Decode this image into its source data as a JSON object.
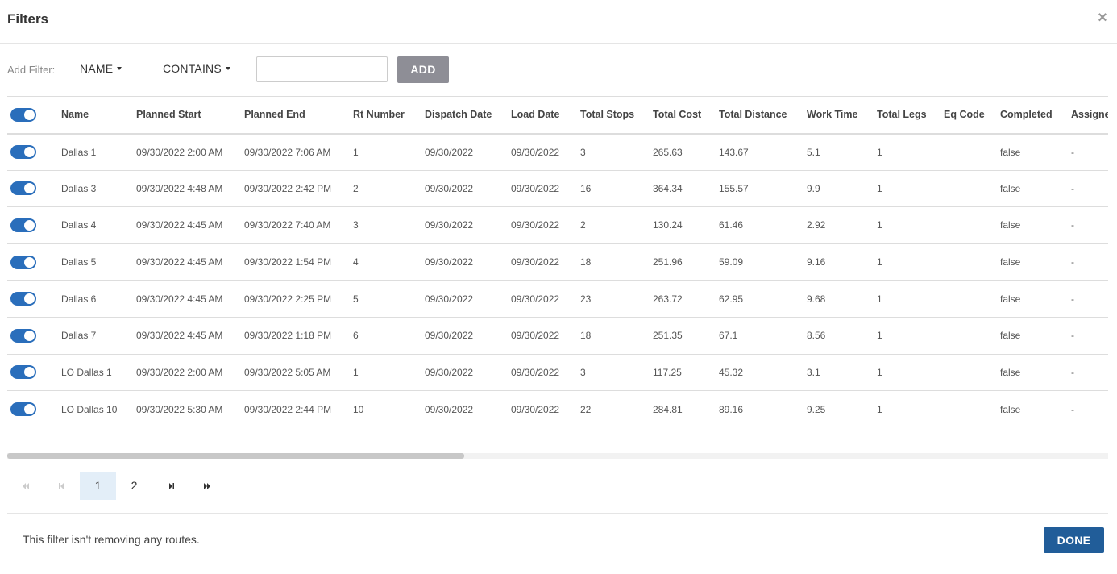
{
  "header": {
    "title": "Filters",
    "close_glyph": "×"
  },
  "filter_bar": {
    "label": "Add Filter:",
    "field_dropdown": "NAME",
    "operator_dropdown": "CONTAINS",
    "input_value": "",
    "input_placeholder": "",
    "add_label": "ADD"
  },
  "table": {
    "columns": [
      "Name",
      "Planned Start",
      "Planned End",
      "Rt Number",
      "Dispatch Date",
      "Load Date",
      "Total Stops",
      "Total Cost",
      "Total Distance",
      "Work Time",
      "Total Legs",
      "Eq Code",
      "Completed",
      "Assigned"
    ],
    "rows": [
      [
        "Dallas 1",
        "09/30/2022 2:00 AM",
        "09/30/2022 7:06 AM",
        "1",
        "09/30/2022",
        "09/30/2022",
        "3",
        "265.63",
        "143.67",
        "5.1",
        "1",
        "",
        "false",
        "-"
      ],
      [
        "Dallas 3",
        "09/30/2022 4:48 AM",
        "09/30/2022 2:42 PM",
        "2",
        "09/30/2022",
        "09/30/2022",
        "16",
        "364.34",
        "155.57",
        "9.9",
        "1",
        "",
        "false",
        "-"
      ],
      [
        "Dallas 4",
        "09/30/2022 4:45 AM",
        "09/30/2022 7:40 AM",
        "3",
        "09/30/2022",
        "09/30/2022",
        "2",
        "130.24",
        "61.46",
        "2.92",
        "1",
        "",
        "false",
        "-"
      ],
      [
        "Dallas 5",
        "09/30/2022 4:45 AM",
        "09/30/2022 1:54 PM",
        "4",
        "09/30/2022",
        "09/30/2022",
        "18",
        "251.96",
        "59.09",
        "9.16",
        "1",
        "",
        "false",
        "-"
      ],
      [
        "Dallas 6",
        "09/30/2022 4:45 AM",
        "09/30/2022 2:25 PM",
        "5",
        "09/30/2022",
        "09/30/2022",
        "23",
        "263.72",
        "62.95",
        "9.68",
        "1",
        "",
        "false",
        "-"
      ],
      [
        "Dallas 7",
        "09/30/2022 4:45 AM",
        "09/30/2022 1:18 PM",
        "6",
        "09/30/2022",
        "09/30/2022",
        "18",
        "251.35",
        "67.1",
        "8.56",
        "1",
        "",
        "false",
        "-"
      ],
      [
        "LO Dallas 1",
        "09/30/2022 2:00 AM",
        "09/30/2022 5:05 AM",
        "1",
        "09/30/2022",
        "09/30/2022",
        "3",
        "117.25",
        "45.32",
        "3.1",
        "1",
        "",
        "false",
        "-"
      ],
      [
        "LO Dallas 10",
        "09/30/2022 5:30 AM",
        "09/30/2022 2:44 PM",
        "10",
        "09/30/2022",
        "09/30/2022",
        "22",
        "284.81",
        "89.16",
        "9.25",
        "1",
        "",
        "false",
        "-"
      ]
    ],
    "row_toggles_on": [
      true,
      true,
      true,
      true,
      true,
      true,
      true,
      true
    ],
    "header_toggle_on": true
  },
  "pager": {
    "pages": [
      "1",
      "2"
    ],
    "current_page": "1",
    "icons": [
      "first-page-icon",
      "prev-page-icon",
      "next-page-icon",
      "last-page-icon"
    ]
  },
  "footer": {
    "message": "This filter isn't removing any routes.",
    "done_label": "DONE"
  },
  "colors": {
    "toggle_on": "#2a6ebb",
    "add_button": "#8e8e96",
    "done_button": "#215d99",
    "active_page": "#e3eef8"
  }
}
